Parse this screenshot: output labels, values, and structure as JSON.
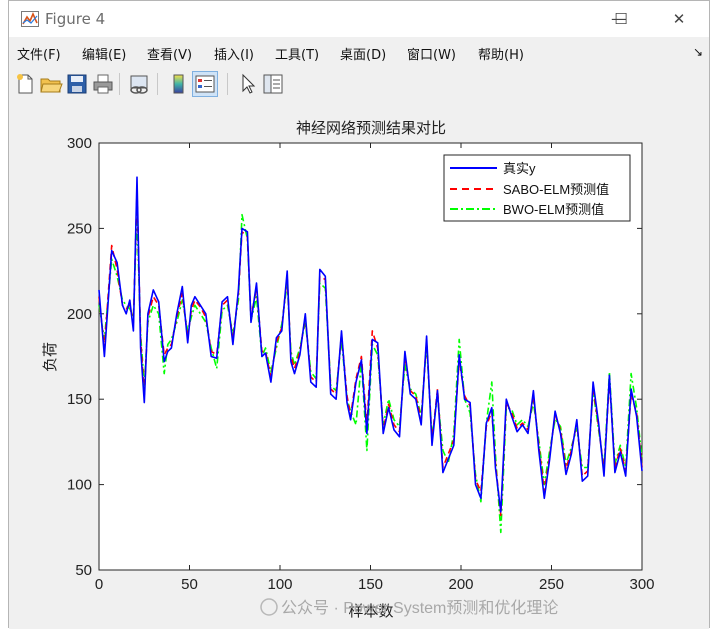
{
  "window": {
    "title": "Figure 4",
    "minimize": "—",
    "maximize": "☐",
    "close": "✕"
  },
  "menu": [
    {
      "label": "文件(F)"
    },
    {
      "label": "编辑(E)"
    },
    {
      "label": "查看(V)"
    },
    {
      "label": "插入(I)"
    },
    {
      "label": "工具(T)"
    },
    {
      "label": "桌面(D)"
    },
    {
      "label": "窗口(W)"
    },
    {
      "label": "帮助(H)"
    }
  ],
  "menu_overflow": "↘",
  "toolbar": [
    "new-file-icon",
    "open-folder-icon",
    "save-icon",
    "print-icon",
    "link-plot-icon",
    "colorbar-icon",
    "legend-icon",
    "pointer-icon",
    "property-inspector-icon"
  ],
  "watermark": "公众号 · Power System预测和优化理论",
  "chart_data": {
    "type": "line",
    "title": "神经网络预测结果对比",
    "xlabel": "样本数",
    "ylabel": "负荷",
    "xlim": [
      0,
      300
    ],
    "ylim": [
      50,
      300
    ],
    "xticks": [
      "0",
      "50",
      "100",
      "150",
      "200",
      "250",
      "300"
    ],
    "yticks": [
      "50",
      "100",
      "150",
      "200",
      "250",
      "300"
    ],
    "legend_position": "top-right",
    "series": [
      {
        "name": "真实y",
        "color": "#0000ff",
        "style": "solid",
        "x": [
          0,
          3,
          7,
          10,
          13,
          15,
          17,
          19,
          21,
          23,
          25,
          27,
          30,
          33,
          36,
          38,
          40,
          43,
          46,
          49,
          51,
          53,
          56,
          59,
          62,
          65,
          68,
          71,
          74,
          77,
          79,
          82,
          84,
          87,
          90,
          92,
          95,
          98,
          101,
          104,
          106,
          108,
          111,
          114,
          117,
          120,
          122,
          125,
          128,
          131,
          134,
          137,
          139,
          142,
          145,
          148,
          151,
          154,
          157,
          160,
          163,
          166,
          169,
          172,
          175,
          178,
          181,
          184,
          187,
          190,
          193,
          196,
          199,
          202,
          205,
          208,
          211,
          214,
          217,
          219,
          222,
          225,
          228,
          231,
          234,
          237,
          240,
          243,
          246,
          249,
          252,
          255,
          258,
          261,
          264,
          267,
          270,
          273,
          276,
          279,
          282,
          285,
          288,
          291,
          294,
          297,
          300
        ],
        "values": [
          214,
          175,
          237,
          230,
          205,
          200,
          208,
          190,
          280,
          180,
          148,
          200,
          214,
          207,
          172,
          178,
          180,
          200,
          216,
          183,
          205,
          210,
          205,
          200,
          175,
          174,
          207,
          210,
          182,
          214,
          250,
          248,
          195,
          218,
          175,
          177,
          160,
          186,
          190,
          225,
          172,
          165,
          176,
          200,
          160,
          157,
          226,
          222,
          153,
          150,
          190,
          148,
          138,
          160,
          173,
          130,
          185,
          183,
          130,
          145,
          132,
          128,
          178,
          153,
          150,
          135,
          187,
          123,
          155,
          107,
          115,
          123,
          176,
          150,
          148,
          100,
          92,
          136,
          145,
          110,
          84,
          150,
          140,
          131,
          135,
          130,
          155,
          120,
          92,
          115,
          143,
          130,
          106,
          118,
          138,
          102,
          105,
          160,
          136,
          105,
          164,
          107,
          119,
          105,
          156,
          140,
          108
        ]
      },
      {
        "name": "SABO-ELM预测值",
        "color": "#ff0000",
        "style": "dashed",
        "x": [
          0,
          3,
          7,
          10,
          13,
          15,
          17,
          19,
          21,
          23,
          25,
          27,
          30,
          33,
          36,
          38,
          40,
          43,
          46,
          49,
          51,
          53,
          56,
          59,
          62,
          65,
          68,
          71,
          74,
          77,
          79,
          82,
          84,
          87,
          90,
          92,
          95,
          98,
          101,
          104,
          106,
          108,
          111,
          114,
          117,
          120,
          122,
          125,
          128,
          131,
          134,
          137,
          139,
          142,
          145,
          148,
          151,
          154,
          157,
          160,
          163,
          166,
          169,
          172,
          175,
          178,
          181,
          184,
          187,
          190,
          193,
          196,
          199,
          202,
          205,
          208,
          211,
          214,
          217,
          219,
          222,
          225,
          228,
          231,
          234,
          237,
          240,
          243,
          246,
          249,
          252,
          255,
          258,
          261,
          264,
          267,
          270,
          273,
          276,
          279,
          282,
          285,
          288,
          291,
          294,
          297,
          300
        ],
        "values": [
          210,
          180,
          240,
          226,
          205,
          203,
          205,
          195,
          272,
          186,
          152,
          198,
          210,
          205,
          176,
          180,
          182,
          198,
          212,
          186,
          202,
          208,
          204,
          198,
          178,
          176,
          205,
          208,
          185,
          212,
          248,
          245,
          198,
          215,
          178,
          178,
          163,
          183,
          192,
          222,
          175,
          168,
          178,
          198,
          163,
          160,
          222,
          220,
          156,
          153,
          188,
          152,
          140,
          162,
          175,
          135,
          190,
          180,
          132,
          147,
          135,
          131,
          175,
          155,
          152,
          138,
          185,
          126,
          156,
          110,
          118,
          126,
          173,
          152,
          146,
          103,
          96,
          134,
          143,
          113,
          82,
          148,
          142,
          133,
          136,
          132,
          152,
          123,
          96,
          117,
          141,
          132,
          109,
          120,
          136,
          105,
          108,
          157,
          134,
          108,
          161,
          110,
          121,
          108,
          153,
          142,
          110
        ]
      },
      {
        "name": "BWO-ELM预测值",
        "color": "#00ff00",
        "style": "dashdot",
        "x": [
          0,
          3,
          7,
          10,
          13,
          15,
          17,
          19,
          21,
          23,
          25,
          27,
          30,
          33,
          36,
          38,
          40,
          43,
          46,
          49,
          51,
          53,
          56,
          59,
          62,
          65,
          68,
          71,
          74,
          77,
          79,
          82,
          84,
          87,
          90,
          92,
          95,
          98,
          101,
          104,
          106,
          108,
          111,
          114,
          117,
          120,
          122,
          125,
          128,
          131,
          134,
          137,
          139,
          142,
          145,
          148,
          151,
          154,
          157,
          160,
          163,
          166,
          169,
          172,
          175,
          178,
          181,
          184,
          187,
          190,
          193,
          196,
          199,
          202,
          205,
          208,
          211,
          214,
          217,
          219,
          222,
          225,
          228,
          231,
          234,
          237,
          240,
          243,
          246,
          249,
          252,
          255,
          258,
          261,
          264,
          267,
          270,
          273,
          276,
          279,
          282,
          285,
          288,
          291,
          294,
          297,
          300
        ],
        "values": [
          205,
          185,
          232,
          222,
          208,
          205,
          203,
          198,
          258,
          188,
          158,
          195,
          205,
          200,
          165,
          182,
          185,
          195,
          208,
          190,
          198,
          205,
          200,
          195,
          180,
          168,
          202,
          205,
          188,
          208,
          258,
          244,
          196,
          210,
          175,
          180,
          166,
          180,
          194,
          218,
          178,
          170,
          180,
          195,
          166,
          162,
          218,
          215,
          158,
          155,
          185,
          150,
          143,
          135,
          172,
          120,
          182,
          176,
          135,
          150,
          138,
          134,
          170,
          156,
          153,
          140,
          182,
          128,
          152,
          120,
          113,
          130,
          185,
          150,
          142,
          106,
          90,
          136,
          160,
          118,
          72,
          145,
          144,
          135,
          138,
          134,
          148,
          126,
          100,
          120,
          138,
          134,
          112,
          122,
          133,
          110,
          110,
          155,
          132,
          110,
          166,
          112,
          123,
          110,
          165,
          145,
          115
        ]
      }
    ]
  }
}
